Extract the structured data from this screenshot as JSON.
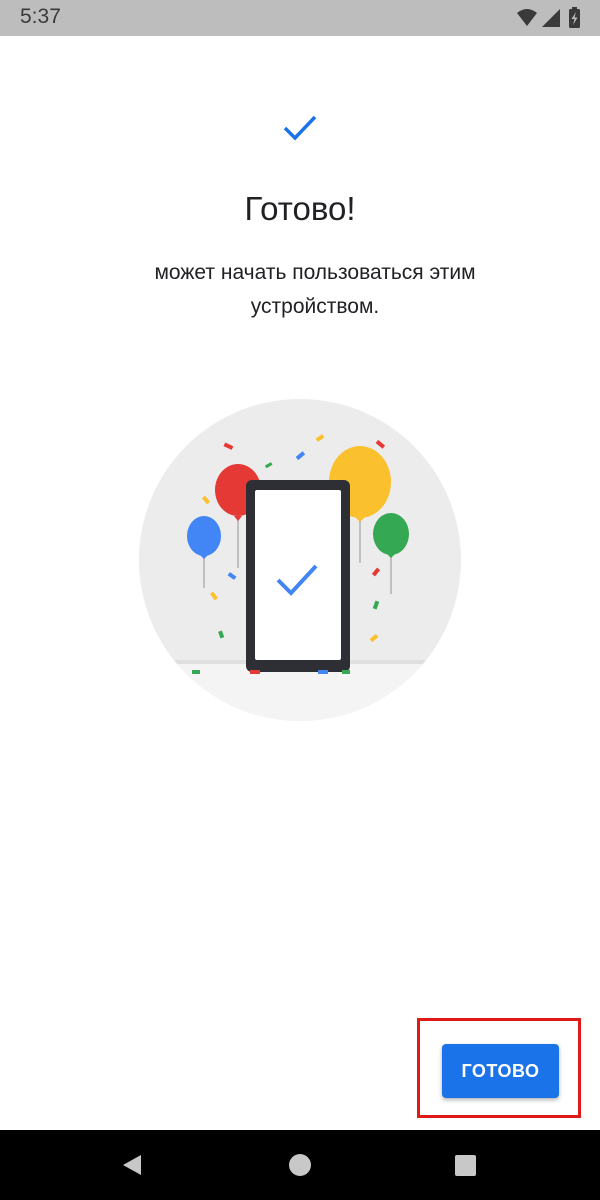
{
  "status_bar": {
    "time": "5:37",
    "icons": [
      "wifi-icon",
      "cell-signal-icon",
      "battery-charging-icon"
    ]
  },
  "main": {
    "check_icon": "checkmark-icon",
    "title": "Готово!",
    "subtitle": "может начать пользоваться этим устройством.",
    "illustration": "phone-celebration-illustration"
  },
  "footer": {
    "done_label": "ГОТОВО"
  },
  "nav_bar": {
    "icons": [
      "back-icon",
      "home-icon",
      "recents-icon"
    ]
  },
  "colors": {
    "accent": "#1a73e8",
    "highlight": "#e01919",
    "status_bar": "#bdbdbd",
    "nav_bar": "#000000"
  }
}
